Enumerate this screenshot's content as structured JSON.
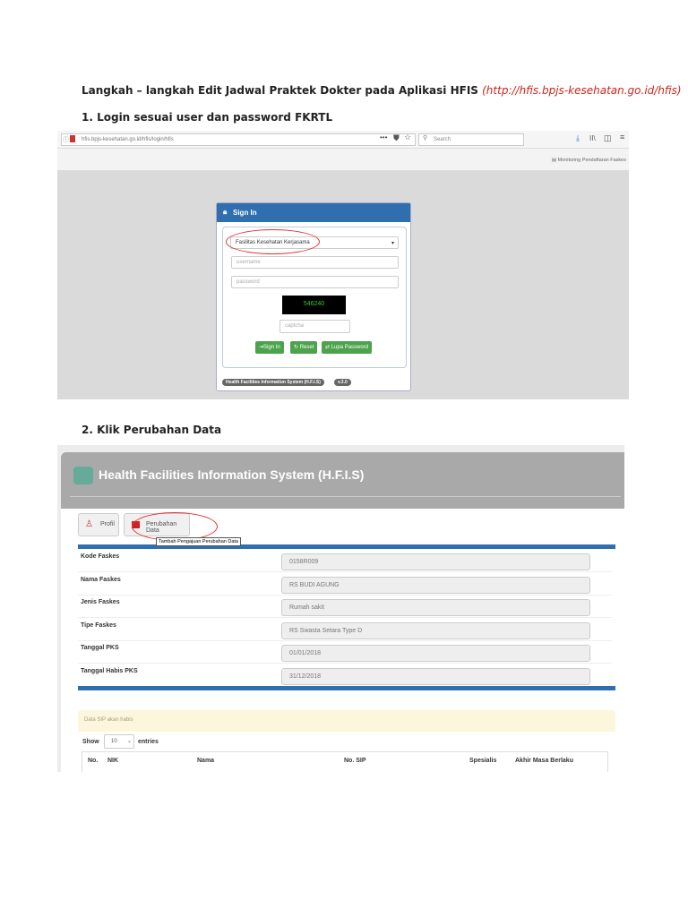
{
  "title": {
    "main": "Langkah – langkah Edit Jadwal Praktek Dokter pada Aplikasi HFIS",
    "url": "(http://hfis.bpjs-kesehatan.go.id/hfis)"
  },
  "step1": "1.  Login sesuai user dan password FKRTL",
  "step2": "2.  Klik Perubahan Data",
  "browser": {
    "url": "hfis.bpjs-kesehatan.go.id/hfis/login/hfis",
    "search": "Search",
    "menu_icons": [
      "more-icon",
      "shield-icon",
      "star-icon",
      "download-icon",
      "library-icon",
      "sidebar-icon",
      "hamburger-icon"
    ],
    "monitoring_link": "Monitoring Pendaftaran Faskes"
  },
  "login": {
    "header": "Sign In",
    "select": "Fasilitas Kesehatan Kerjasama",
    "username_ph": "username",
    "password_ph": "password",
    "captcha_code": "546240",
    "captcha_ph": "captcha",
    "btn_signin": "Sign In",
    "btn_reset": "Reset",
    "btn_lupa": "Lupa Password",
    "footer": "Health Facilities Information System (H.F.I.S)",
    "version": "v.3.0"
  },
  "hfis": {
    "title": "Health Facilities Information System (H.F.I.S)",
    "btn_profil": "Profil",
    "btn_perubahan": "Perubahan Data",
    "tooltip": "Tambah Pengajuan Perubahan Data",
    "rows": [
      {
        "label": "Kode Faskes",
        "value": "0158R009"
      },
      {
        "label": "Nama Faskes",
        "value": "RS BUDI AGUNG"
      },
      {
        "label": "Jenis Faskes",
        "value": "Rumah sakit"
      },
      {
        "label": "Tipe Faskes",
        "value": "RS Swasta Setara Type D"
      },
      {
        "label": "Tanggal PKS",
        "value": "01/01/2018"
      },
      {
        "label": "Tanggal Habis PKS",
        "value": "31/12/2018"
      }
    ],
    "sip_panel": "Data SIP akan habis",
    "show": "Show",
    "entries_value": "10",
    "entries": "entries",
    "columns": [
      "No.",
      "NIK",
      "Nama",
      "No. SIP",
      "Spesialis",
      "Akhir Masa Berlaku"
    ]
  }
}
